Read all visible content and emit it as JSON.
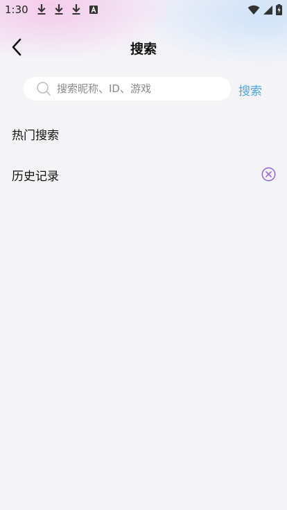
{
  "status_bar": {
    "time": "1:30",
    "left_icons": [
      "download-icon",
      "download-icon",
      "download-icon",
      "a-box-icon"
    ],
    "right_icons": [
      "wifi-icon",
      "signal-icon",
      "battery-charging-icon"
    ]
  },
  "nav": {
    "back_icon": "chevron-left-icon",
    "title": "搜索"
  },
  "search": {
    "placeholder": "搜索昵称、ID、游戏",
    "value": "",
    "icon": "search-icon",
    "submit_label": "搜索"
  },
  "sections": {
    "hot": {
      "title": "热门搜索"
    },
    "history": {
      "title": "历史记录",
      "clear_icon": "clear-circle-x-icon"
    }
  },
  "colors": {
    "accent_blue": "#4ea6e6",
    "clear_purple": "#9b6bd8",
    "page_background": "#f4f4f7",
    "gradient_pink": "#f4c4e8",
    "gradient_blue": "#cce2f8"
  }
}
